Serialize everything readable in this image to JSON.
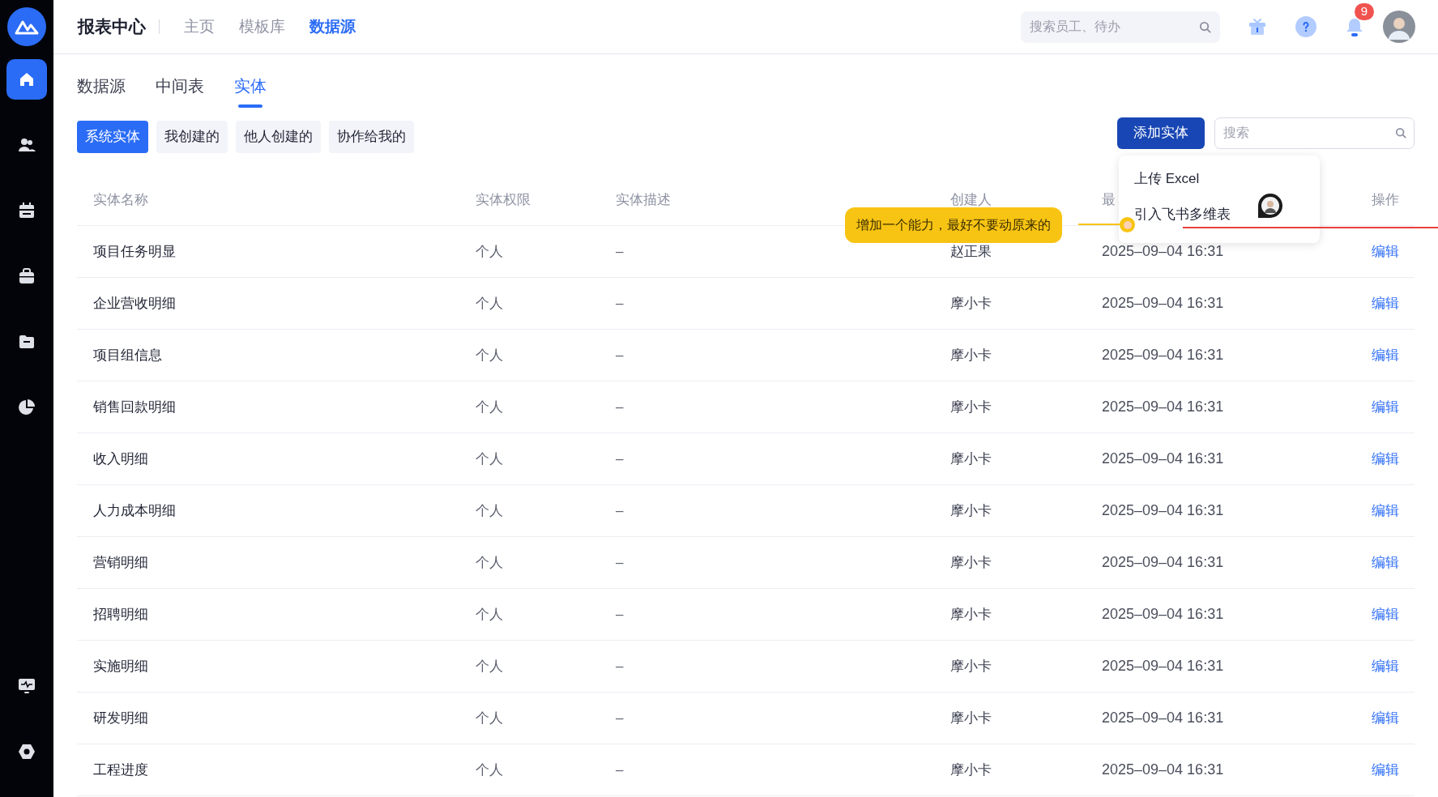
{
  "sidebar": {
    "items": [
      {
        "kind": "home",
        "selected": true
      },
      {
        "kind": "people",
        "selected": false
      },
      {
        "kind": "calendar",
        "selected": false
      },
      {
        "kind": "bag",
        "selected": false
      },
      {
        "kind": "folder",
        "selected": false
      },
      {
        "kind": "pie",
        "selected": false
      },
      {
        "kind": "monitor",
        "selected": false
      },
      {
        "kind": "hexagon",
        "selected": false
      }
    ]
  },
  "header": {
    "title": "报表中心",
    "nav": [
      {
        "label": "主页",
        "selected": false
      },
      {
        "label": "模板库",
        "selected": false
      },
      {
        "label": "数据源",
        "selected": true
      }
    ],
    "search": {
      "placeholder": "搜索员工、待办"
    },
    "notification_count": "9"
  },
  "tabs": [
    {
      "label": "数据源",
      "selected": false
    },
    {
      "label": "中间表",
      "selected": false
    },
    {
      "label": "实体",
      "selected": true
    }
  ],
  "filters": [
    {
      "label": "系统实体",
      "selected": true
    },
    {
      "label": "我创建的",
      "selected": false
    },
    {
      "label": "他人创建的",
      "selected": false
    },
    {
      "label": "协作给我的",
      "selected": false
    }
  ],
  "add_button": {
    "label": "添加实体"
  },
  "search": {
    "placeholder": "搜索"
  },
  "add_menu": {
    "items": [
      "上传 Excel",
      "引入飞书多维表"
    ]
  },
  "table": {
    "columns": [
      "实体名称",
      "实体权限",
      "实体描述",
      "创建人",
      "最",
      "操作"
    ],
    "rows": [
      {
        "name": "项目任务明显",
        "permission": "个人",
        "description": "–",
        "creator": "赵正果",
        "time": "2025–09–04 16:31",
        "action": "编辑"
      },
      {
        "name": "企业营收明细",
        "permission": "个人",
        "description": "–",
        "creator": "摩小卡",
        "time": "2025–09–04 16:31",
        "action": "编辑"
      },
      {
        "name": "项目组信息",
        "permission": "个人",
        "description": "–",
        "creator": "摩小卡",
        "time": "2025–09–04 16:31",
        "action": "编辑"
      },
      {
        "name": "销售回款明细",
        "permission": "个人",
        "description": "–",
        "creator": "摩小卡",
        "time": "2025–09–04 16:31",
        "action": "编辑"
      },
      {
        "name": "收入明细",
        "permission": "个人",
        "description": "–",
        "creator": "摩小卡",
        "time": "2025–09–04 16:31",
        "action": "编辑"
      },
      {
        "name": "人力成本明细",
        "permission": "个人",
        "description": "–",
        "creator": "摩小卡",
        "time": "2025–09–04 16:31",
        "action": "编辑"
      },
      {
        "name": "营销明细",
        "permission": "个人",
        "description": "–",
        "creator": "摩小卡",
        "time": "2025–09–04 16:31",
        "action": "编辑"
      },
      {
        "name": "招聘明细",
        "permission": "个人",
        "description": "–",
        "creator": "摩小卡",
        "time": "2025–09–04 16:31",
        "action": "编辑"
      },
      {
        "name": "实施明细",
        "permission": "个人",
        "description": "–",
        "creator": "摩小卡",
        "time": "2025–09–04 16:31",
        "action": "编辑"
      },
      {
        "name": "研发明细",
        "permission": "个人",
        "description": "–",
        "creator": "摩小卡",
        "time": "2025–09–04 16:31",
        "action": "编辑"
      },
      {
        "name": "工程进度",
        "permission": "个人",
        "description": "–",
        "creator": "摩小卡",
        "time": "2025–09–04 16:31",
        "action": "编辑"
      }
    ]
  },
  "annotation": {
    "text": "增加一个能力，最好不要动原来的"
  }
}
